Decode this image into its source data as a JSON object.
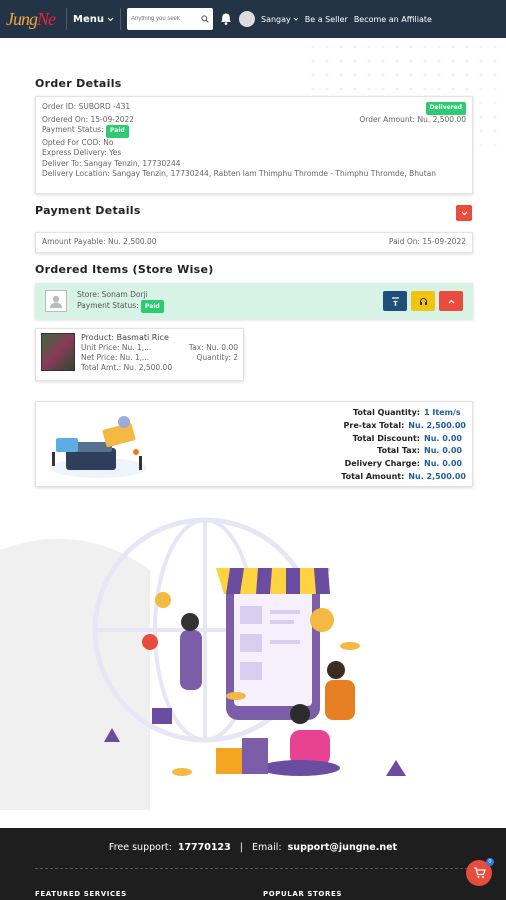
{
  "header": {
    "logo_text_a": "Jung",
    "logo_text_b": "Ne",
    "menu_label": "Menu",
    "search_placeholder": "Anything you seek",
    "user_name": "Sangay",
    "be_seller": "Be a Seller",
    "affiliate": "Become an Affiliate"
  },
  "order": {
    "section_title": "Order Details",
    "order_id": "Order ID: SUBORD -431",
    "status": "Delivered",
    "ordered_on": "Ordered On: 15-09-2022",
    "order_amount": "Order Amount: Nu. 2,500.00",
    "payment_status_label": "Payment Status:",
    "payment_status": "Paid",
    "cod": "Opted For COD: No",
    "express": "Express Delivery: Yes",
    "deliver_to": "Deliver To: Sangay Tenzin, 17730244",
    "location": "Delivery Location: Sangay Tenzin, 17730244, Rabten lam Thimphu Thromde - Thimphu Thromde, Bhutan"
  },
  "payment": {
    "section_title": "Payment Details",
    "amount_payable": "Amount Payable: Nu. 2,500.00",
    "paid_on": "Paid On: 15-09-2022"
  },
  "items": {
    "section_title": "Ordered Items (Store Wise)",
    "store_name": "Store: Sonam Dorji",
    "store_payment_label": "Payment Status:",
    "store_payment": "Paid",
    "product": "Product: Basmati Rice",
    "unit_price": "Unit Price: Nu. 1,...",
    "tax": "Tax: Nu. 0.00",
    "net_price": "Net Price: Nu. 1,...",
    "quantity": "Quantity: 2",
    "total_amt": "Total Amt.: Nu. 2,500.00"
  },
  "totals": {
    "rows": [
      {
        "label": "Total Quantity:",
        "value": "1 Item/s"
      },
      {
        "label": "Pre-tax Total:",
        "value": "Nu. 2,500.00"
      },
      {
        "label": "Total Discount:",
        "value": "Nu. 0.00"
      },
      {
        "label": "Total Tax:",
        "value": "Nu. 0.00"
      },
      {
        "label": "Delivery Charge:",
        "value": "Nu. 0.00"
      },
      {
        "label": "Total Amount:",
        "value": "Nu. 2,500.00"
      }
    ]
  },
  "footer": {
    "support_label": "Free support:",
    "phone": "17770123",
    "sep": "|",
    "email_label": "Email:",
    "email": "support@jungne.net",
    "featured": "FEATURED SERVICES",
    "popular": "POPULAR STORES",
    "cart_count": "0"
  },
  "icons": [
    "search-icon",
    "chevron-down-icon",
    "bell-icon",
    "filter-icon",
    "headset-icon",
    "chevron-up-icon",
    "cart-icon",
    "user-placeholder-icon"
  ],
  "colors": {
    "header_bg": "#243447",
    "paid_green": "#2ecc71",
    "accent_red": "#e74c3c",
    "store_bg": "#d7f3e6",
    "footer_bg": "#1e1e1e"
  }
}
